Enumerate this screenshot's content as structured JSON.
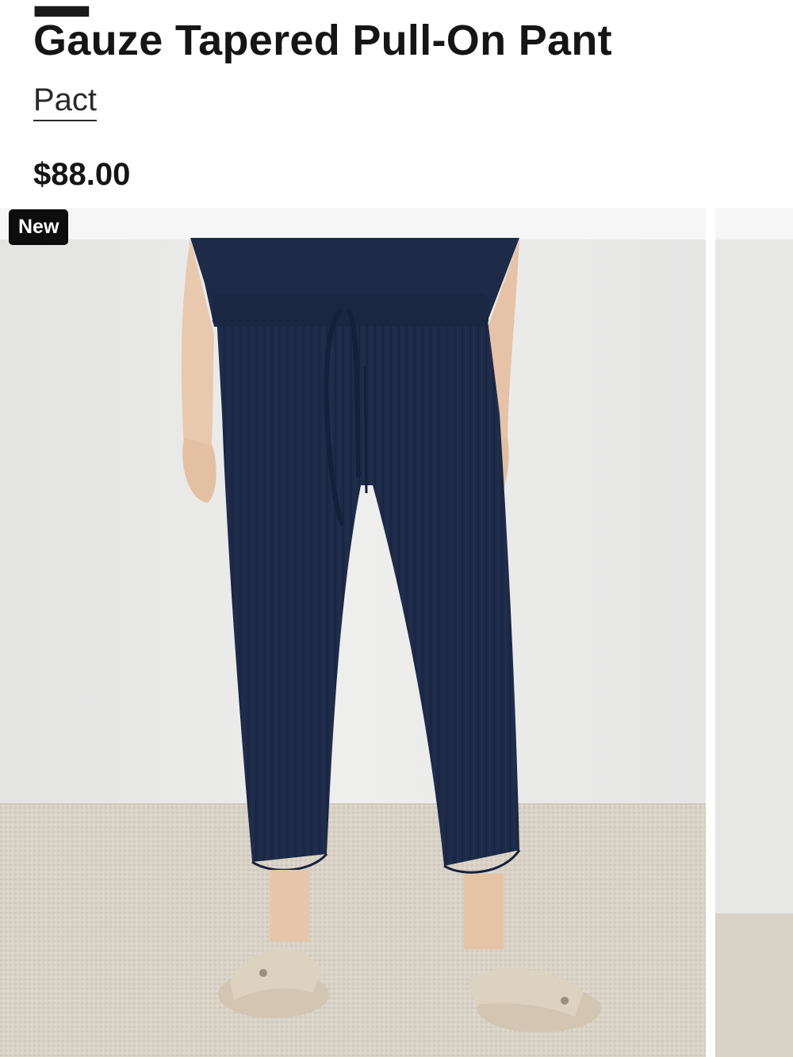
{
  "product": {
    "title": "Gauze Tapered Pull-On Pant",
    "brand": "Pact",
    "price": "$88.00"
  },
  "gallery": {
    "badge": "New",
    "images": [
      {
        "alt": "Model wearing navy gauze tapered pull-on pant with beige sandals"
      },
      {
        "alt": "Next product image (partially visible)"
      }
    ]
  },
  "colors": {
    "pant": "#1d2b49",
    "wall": "#e9e9e8",
    "floor": "#d8d1c6",
    "badge_bg": "#0d0d0d"
  }
}
